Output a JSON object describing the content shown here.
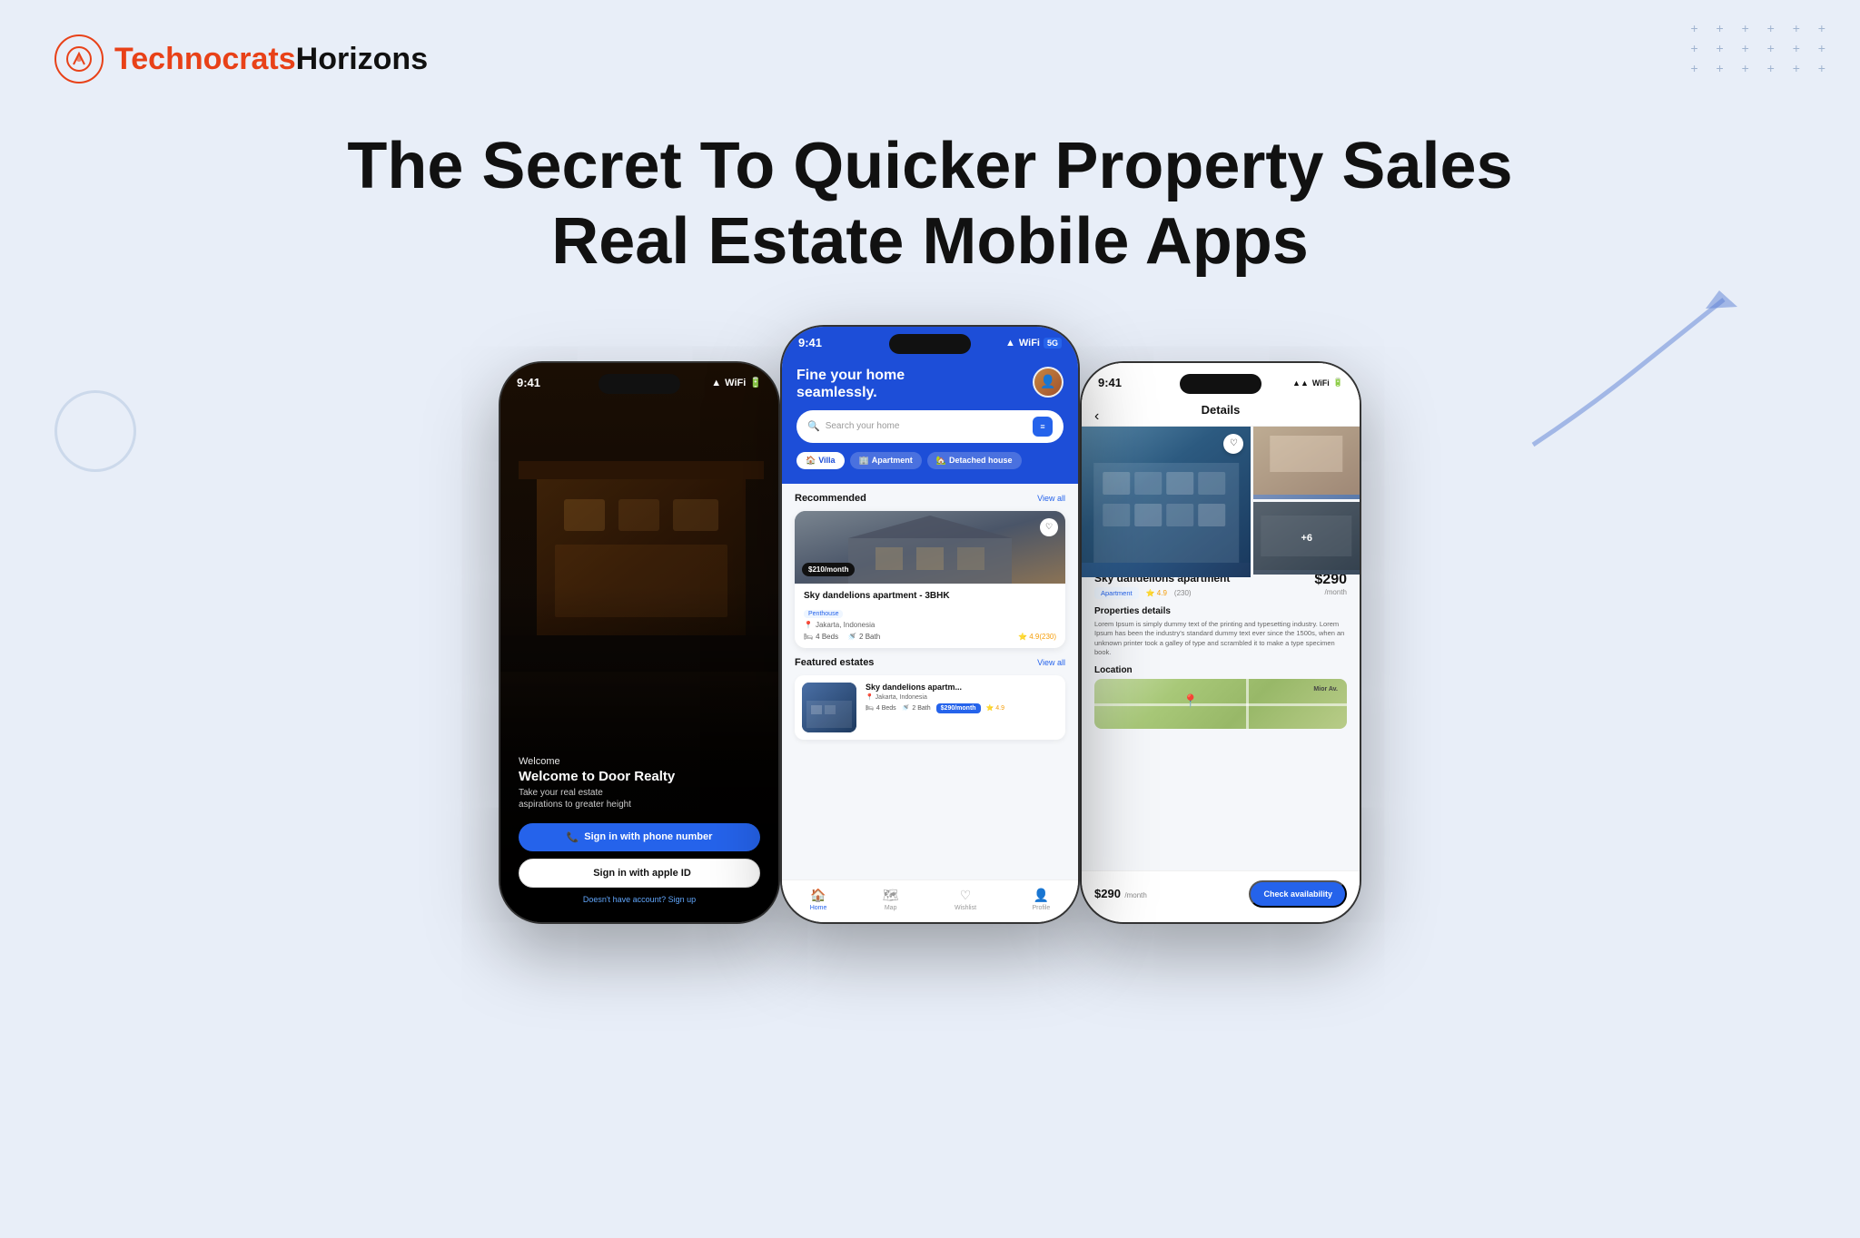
{
  "brand": {
    "name_part1": "Technocrats",
    "name_part2": "Horizons",
    "icon": "🔧"
  },
  "page": {
    "title_line1": "The Secret To Quicker Property Sales",
    "title_line2": "Real Estate Mobile Apps"
  },
  "phone1": {
    "status_time": "9:41",
    "welcome_label": "Welcome",
    "app_name": "Welcome to Door Realty",
    "tagline": "Take your real estate\naspirations to greater height",
    "btn_phone": "Sign in with phone number",
    "btn_apple": "Sign in with apple ID",
    "no_account": "Doesn't have account?",
    "sign_up": "Sign up"
  },
  "phone2": {
    "status_time": "9:41",
    "greeting": "Fine your home\nseamlessly.",
    "search_placeholder": "Search your home",
    "tabs": [
      "Villa",
      "Apartment",
      "Detached house"
    ],
    "sections": {
      "recommended": "Recommended",
      "view_all_1": "View all",
      "featured": "Featured estates",
      "view_all_2": "View all"
    },
    "recommended_card": {
      "price": "$210/month",
      "title": "Sky dandelions apartment - 3BHK",
      "badge": "Penthouse",
      "location": "Jakarta, Indonesia",
      "beds": "4 Beds",
      "baths": "2 Bath",
      "rating": "4.9(230)"
    },
    "featured_card": {
      "title": "Sky dandelions apartm...",
      "location": "Jakarta, Indonesia",
      "beds": "4 Beds",
      "baths": "2 Bath",
      "price": "$290/month",
      "rating": "4.9"
    },
    "nav": [
      "Home",
      "Map",
      "Wishlist",
      "Profile"
    ]
  },
  "phone3": {
    "status_time": "9:41",
    "back_icon": "‹",
    "title": "Details",
    "prop_name": "Sky dandelions apartment",
    "prop_type": "Apartment",
    "rating": "4.9",
    "reviews": "(230)",
    "more_photos": "+6",
    "sections": {
      "details_label": "Properties details",
      "details_text": "Lorem Ipsum is simply dummy text of the printing and typesetting industry. Lorem Ipsum has been the industry's standard dummy text ever since the 1500s, when an unknown printer took a galley of type and scrambled it to make a type specimen book.",
      "location_label": "Location",
      "map_text": "Mior Av."
    },
    "price": "$290",
    "price_sub": "/month",
    "price_badge": "$290",
    "check_btn": "Check availability"
  },
  "decorative": {
    "dots_rows": [
      "+ + + + + +",
      "+ + + + + +",
      "+ + + + + +"
    ]
  }
}
